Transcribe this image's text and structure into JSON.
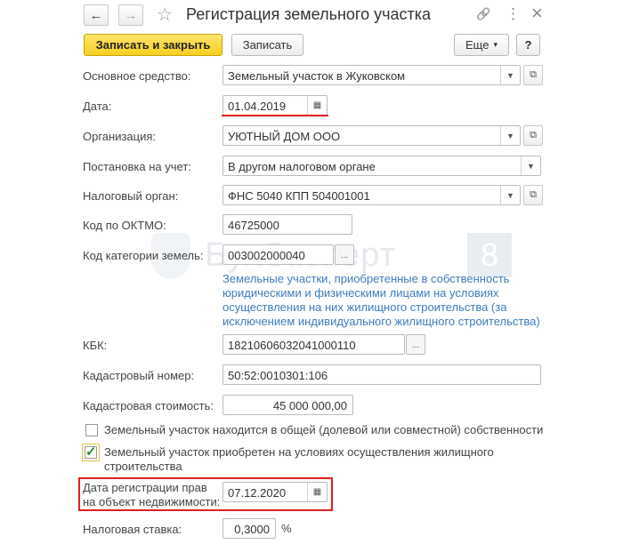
{
  "window": {
    "title": "Регистрация земельного участка",
    "back_glyph": "←",
    "forward_glyph": "→",
    "star_glyph": "☆",
    "link_glyph": "🔗",
    "more_glyph": "⋮",
    "close_glyph": "×"
  },
  "toolbar": {
    "save_close_label": "Записать и закрыть",
    "save_label": "Записать",
    "more_label": "Еще",
    "more_arrow": "▾",
    "help_label": "?"
  },
  "form": {
    "asset": {
      "label": "Основное средство:",
      "value": "Земельный участок в Жуковском"
    },
    "date": {
      "label": "Дата:",
      "value": "01.04.2019"
    },
    "organization": {
      "label": "Организация:",
      "value": "УЮТНЫЙ ДОМ ООО"
    },
    "registration": {
      "label": "Постановка на учет:",
      "value": "В другом налоговом органе"
    },
    "tax_authority": {
      "label": "Налоговый орган:",
      "value": "ФНС 5040 КПП 504001001"
    },
    "oktmo": {
      "label": "Код по ОКТМО:",
      "value": "46725000"
    },
    "land_category": {
      "label": "Код категории земель:",
      "value": "003002000040",
      "description": "Земельные участки, приобретенные в собственность юридическими и физическими лицами на условиях осуществления на них жилищного строительства (за исключением индивидуального жилищного строительства)"
    },
    "kbk": {
      "label": "КБК:",
      "value": "18210606032041000110"
    },
    "cadastral_number": {
      "label": "Кадастровый номер:",
      "value": "50:52:0010301:106"
    },
    "cadastral_value": {
      "label": "Кадастровая стоимость:",
      "value": "45 000 000,00"
    },
    "shared_ownership": {
      "label": "Земельный участок находится в общей (долевой или совместной) собственности",
      "checked": false
    },
    "housing_construction": {
      "label": "Земельный участок приобретен на условиях осуществления жилищного строительства",
      "checked": true
    },
    "rights_date": {
      "label_line1": "Дата регистрации прав",
      "label_line2": "на объект недвижимости:",
      "value": "07.12.2020"
    },
    "tax_rate": {
      "label": "Налоговая ставка:",
      "value": "0,3000",
      "unit": "%"
    }
  },
  "watermark": {
    "text": "БухЭксперт",
    "digit": "8"
  },
  "colors": {
    "primary_button": "#f6cf1f",
    "highlight": "#e02020",
    "link_text": "#3f7bbf"
  }
}
